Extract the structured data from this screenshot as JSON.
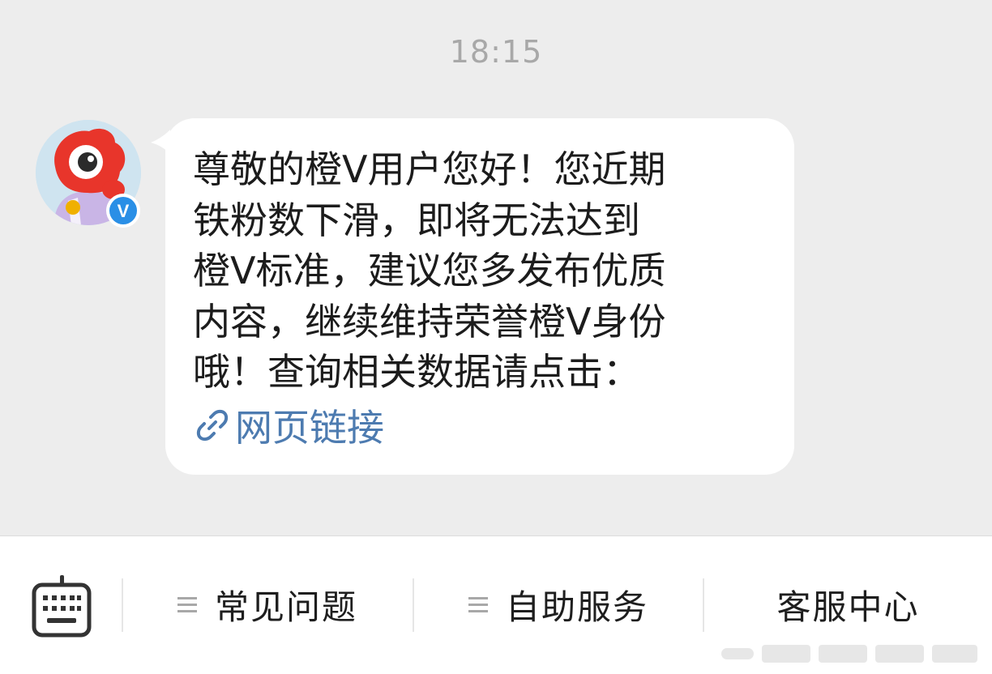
{
  "chat": {
    "timestamp": "18:15",
    "message": {
      "lines": [
        "尊敬的橙V用户您好！您近期",
        "铁粉数下滑，即将无法达到",
        "橙V标准，建议您多发布优质",
        "内容，继续维持荣誉橙V身份",
        "哦！查询相关数据请点击："
      ],
      "link_label": "网页链接",
      "link_icon": "link-icon"
    },
    "sender": {
      "avatar_icon": "mascot-avatar",
      "badge_icon": "verified-v-badge",
      "badge_letter": "V"
    }
  },
  "bottom_bar": {
    "keyboard_icon": "keyboard-icon",
    "menu": [
      {
        "label": "常见问题",
        "icon": "menu-lines-icon"
      },
      {
        "label": "自助服务",
        "icon": "menu-lines-icon"
      },
      {
        "label": "客服中心"
      }
    ]
  },
  "colors": {
    "background": "#ededed",
    "bubble": "#ffffff",
    "link": "#4d7bb0",
    "badge": "#2a8fe6",
    "mascot": "#e8352b"
  }
}
